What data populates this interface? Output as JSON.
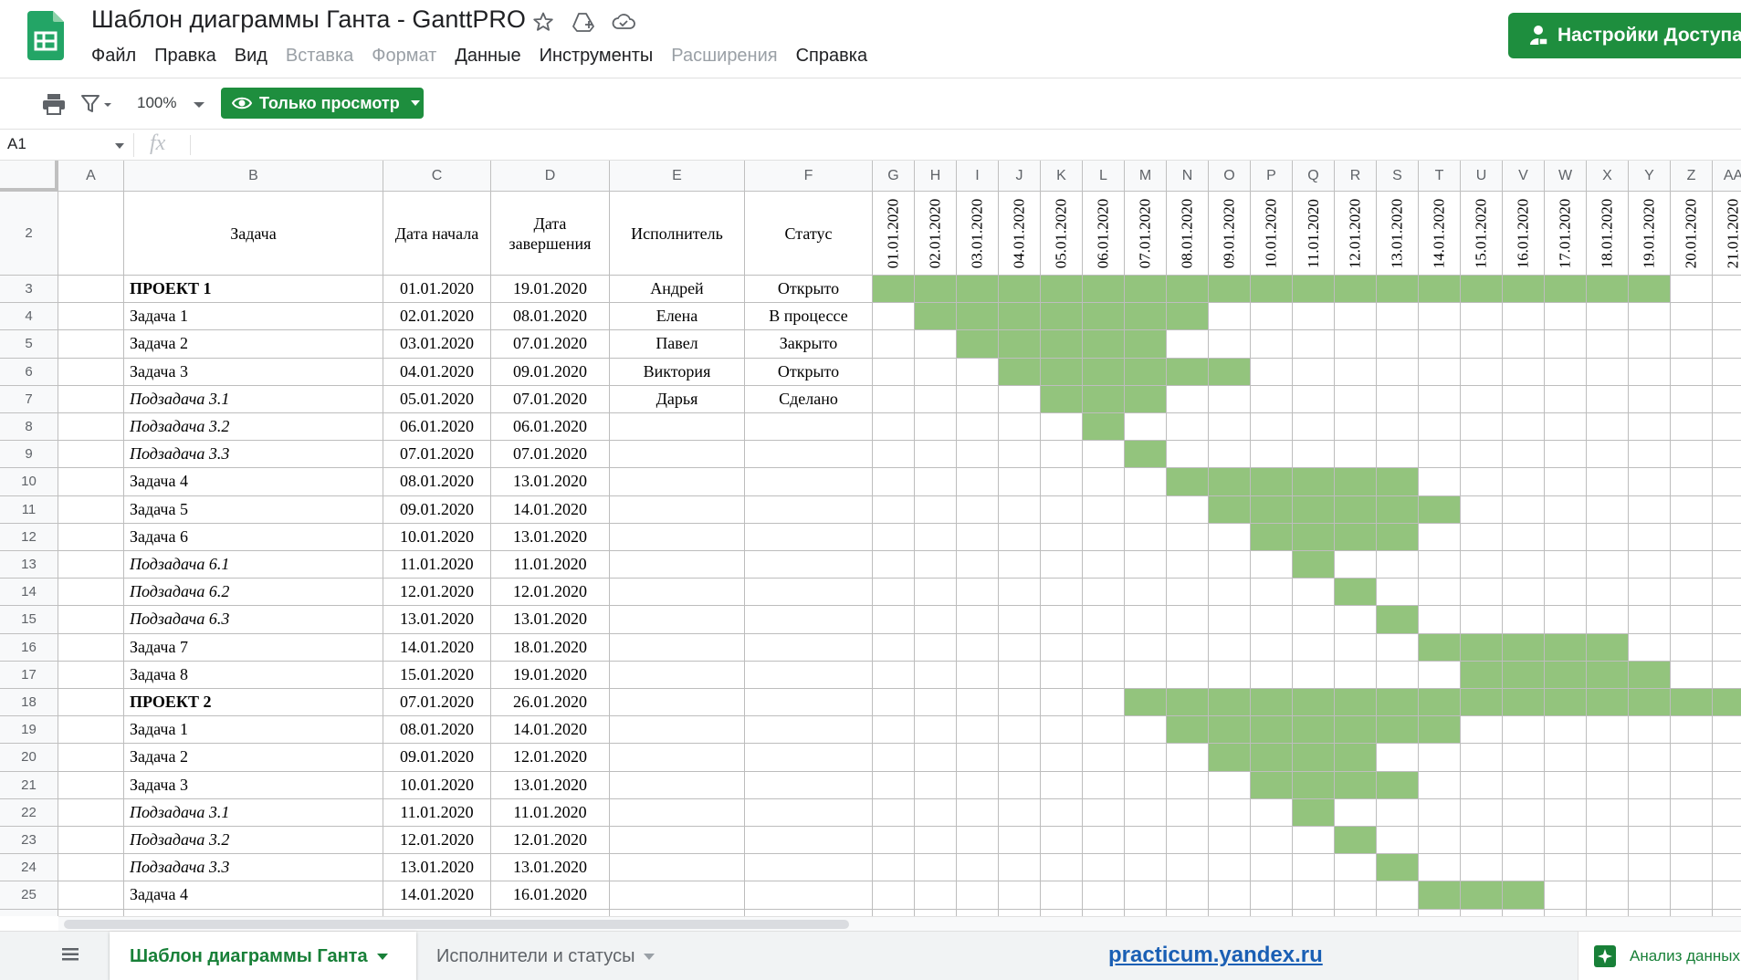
{
  "header": {
    "doc_title": "Шаблон диаграммы Ганта - GanttPRO",
    "menu": [
      {
        "label": "Файл",
        "disabled": false
      },
      {
        "label": "Правка",
        "disabled": false
      },
      {
        "label": "Вид",
        "disabled": false
      },
      {
        "label": "Вставка",
        "disabled": true
      },
      {
        "label": "Формат",
        "disabled": true
      },
      {
        "label": "Данные",
        "disabled": false
      },
      {
        "label": "Инструменты",
        "disabled": false
      },
      {
        "label": "Расширения",
        "disabled": true
      },
      {
        "label": "Справка",
        "disabled": false
      }
    ],
    "share_label": "Настройки Доступа",
    "icons": [
      "star-icon",
      "move-to-drive-icon",
      "cloud-status-icon"
    ]
  },
  "toolbar": {
    "zoom": "100%",
    "view_mode_label": "Только просмотр"
  },
  "formula_bar": {
    "name_box": "A1",
    "fx_label": "fx"
  },
  "grid": {
    "fixed_columns": [
      "A",
      "B",
      "C",
      "D",
      "E",
      "F"
    ],
    "date_columns": [
      "G",
      "H",
      "I",
      "J",
      "K",
      "L",
      "M",
      "N",
      "O",
      "P",
      "Q",
      "R",
      "S",
      "T",
      "U",
      "V",
      "W",
      "X",
      "Y",
      "Z",
      "AA"
    ],
    "dates": [
      "01.01.2020",
      "02.01.2020",
      "03.01.2020",
      "04.01.2020",
      "05.01.2020",
      "06.01.2020",
      "07.01.2020",
      "08.01.2020",
      "09.01.2020",
      "10.01.2020",
      "11.01.2020",
      "12.01.2020",
      "13.01.2020",
      "14.01.2020",
      "15.01.2020",
      "16.01.2020",
      "17.01.2020",
      "18.01.2020",
      "19.01.2020",
      "20.01.2020",
      "21.01.2020"
    ],
    "header_row_number": "2",
    "headers": {
      "task": "Задача",
      "start": "Дата начала",
      "end": "Дата завершения",
      "assignee": "Исполнитель",
      "status": "Статус"
    },
    "rows": [
      {
        "num": "3",
        "task": "ПРОЕКТ 1",
        "style": "bold",
        "start": "01.01.2020",
        "end": "19.01.2020",
        "assignee": "Андрей",
        "status": "Открыто",
        "bar_from": 0,
        "bar_to": 18
      },
      {
        "num": "4",
        "task": "Задача 1",
        "style": "normal",
        "start": "02.01.2020",
        "end": "08.01.2020",
        "assignee": "Елена",
        "status": "В процессе",
        "bar_from": 1,
        "bar_to": 7
      },
      {
        "num": "5",
        "task": "Задача 2",
        "style": "normal",
        "start": "03.01.2020",
        "end": "07.01.2020",
        "assignee": "Павел",
        "status": "Закрыто",
        "bar_from": 2,
        "bar_to": 6
      },
      {
        "num": "6",
        "task": "Задача 3",
        "style": "normal",
        "start": "04.01.2020",
        "end": "09.01.2020",
        "assignee": "Виктория",
        "status": "Открыто",
        "bar_from": 3,
        "bar_to": 8
      },
      {
        "num": "7",
        "task": "Подзадача 3.1",
        "style": "italic",
        "start": "05.01.2020",
        "end": "07.01.2020",
        "assignee": "Дарья",
        "status": "Сделано",
        "bar_from": 4,
        "bar_to": 6
      },
      {
        "num": "8",
        "task": "Подзадача 3.2",
        "style": "italic",
        "start": "06.01.2020",
        "end": "06.01.2020",
        "assignee": "",
        "status": "",
        "bar_from": 5,
        "bar_to": 5
      },
      {
        "num": "9",
        "task": "Подзадача 3.3",
        "style": "italic",
        "start": "07.01.2020",
        "end": "07.01.2020",
        "assignee": "",
        "status": "",
        "bar_from": 6,
        "bar_to": 6
      },
      {
        "num": "10",
        "task": "Задача 4",
        "style": "normal",
        "start": "08.01.2020",
        "end": "13.01.2020",
        "assignee": "",
        "status": "",
        "bar_from": 7,
        "bar_to": 12
      },
      {
        "num": "11",
        "task": "Задача 5",
        "style": "normal",
        "start": "09.01.2020",
        "end": "14.01.2020",
        "assignee": "",
        "status": "",
        "bar_from": 8,
        "bar_to": 13
      },
      {
        "num": "12",
        "task": "Задача 6",
        "style": "normal",
        "start": "10.01.2020",
        "end": "13.01.2020",
        "assignee": "",
        "status": "",
        "bar_from": 9,
        "bar_to": 12
      },
      {
        "num": "13",
        "task": "Подзадача 6.1",
        "style": "italic",
        "start": "11.01.2020",
        "end": "11.01.2020",
        "assignee": "",
        "status": "",
        "bar_from": 10,
        "bar_to": 10
      },
      {
        "num": "14",
        "task": "Подзадача 6.2",
        "style": "italic",
        "start": "12.01.2020",
        "end": "12.01.2020",
        "assignee": "",
        "status": "",
        "bar_from": 11,
        "bar_to": 11
      },
      {
        "num": "15",
        "task": "Подзадача 6.3",
        "style": "italic",
        "start": "13.01.2020",
        "end": "13.01.2020",
        "assignee": "",
        "status": "",
        "bar_from": 12,
        "bar_to": 12
      },
      {
        "num": "16",
        "task": "Задача 7",
        "style": "normal",
        "start": "14.01.2020",
        "end": "18.01.2020",
        "assignee": "",
        "status": "",
        "bar_from": 13,
        "bar_to": 17
      },
      {
        "num": "17",
        "task": "Задача 8",
        "style": "normal",
        "start": "15.01.2020",
        "end": "19.01.2020",
        "assignee": "",
        "status": "",
        "bar_from": 14,
        "bar_to": 18
      },
      {
        "num": "18",
        "task": "ПРОЕКТ 2",
        "style": "bold",
        "start": "07.01.2020",
        "end": "26.01.2020",
        "assignee": "",
        "status": "",
        "bar_from": 6,
        "bar_to": 20
      },
      {
        "num": "19",
        "task": "Задача 1",
        "style": "normal",
        "start": "08.01.2020",
        "end": "14.01.2020",
        "assignee": "",
        "status": "",
        "bar_from": 7,
        "bar_to": 13
      },
      {
        "num": "20",
        "task": "Задача 2",
        "style": "normal",
        "start": "09.01.2020",
        "end": "12.01.2020",
        "assignee": "",
        "status": "",
        "bar_from": 8,
        "bar_to": 11
      },
      {
        "num": "21",
        "task": "Задача 3",
        "style": "normal",
        "start": "10.01.2020",
        "end": "13.01.2020",
        "assignee": "",
        "status": "",
        "bar_from": 9,
        "bar_to": 12
      },
      {
        "num": "22",
        "task": "Подзадача 3.1",
        "style": "italic",
        "start": "11.01.2020",
        "end": "11.01.2020",
        "assignee": "",
        "status": "",
        "bar_from": 10,
        "bar_to": 10
      },
      {
        "num": "23",
        "task": "Подзадача 3.2",
        "style": "italic",
        "start": "12.01.2020",
        "end": "12.01.2020",
        "assignee": "",
        "status": "",
        "bar_from": 11,
        "bar_to": 11
      },
      {
        "num": "24",
        "task": "Подзадача 3.3",
        "style": "italic",
        "start": "13.01.2020",
        "end": "13.01.2020",
        "assignee": "",
        "status": "",
        "bar_from": 12,
        "bar_to": 12
      },
      {
        "num": "25",
        "task": "Задача 4",
        "style": "normal",
        "start": "14.01.2020",
        "end": "16.01.2020",
        "assignee": "",
        "status": "",
        "bar_from": 13,
        "bar_to": 15
      }
    ]
  },
  "bottom": {
    "tabs": [
      {
        "label": "Шаблон диаграммы Ганта",
        "active": true
      },
      {
        "label": "Исполнители и статусы",
        "active": false
      }
    ],
    "watermark": "practicum.yandex.ru",
    "explore_label": "Анализ данных"
  },
  "colors": {
    "brand_green": "#1e8e3e",
    "bar_green": "#93c47d",
    "sheets_logo": "#23a566"
  }
}
